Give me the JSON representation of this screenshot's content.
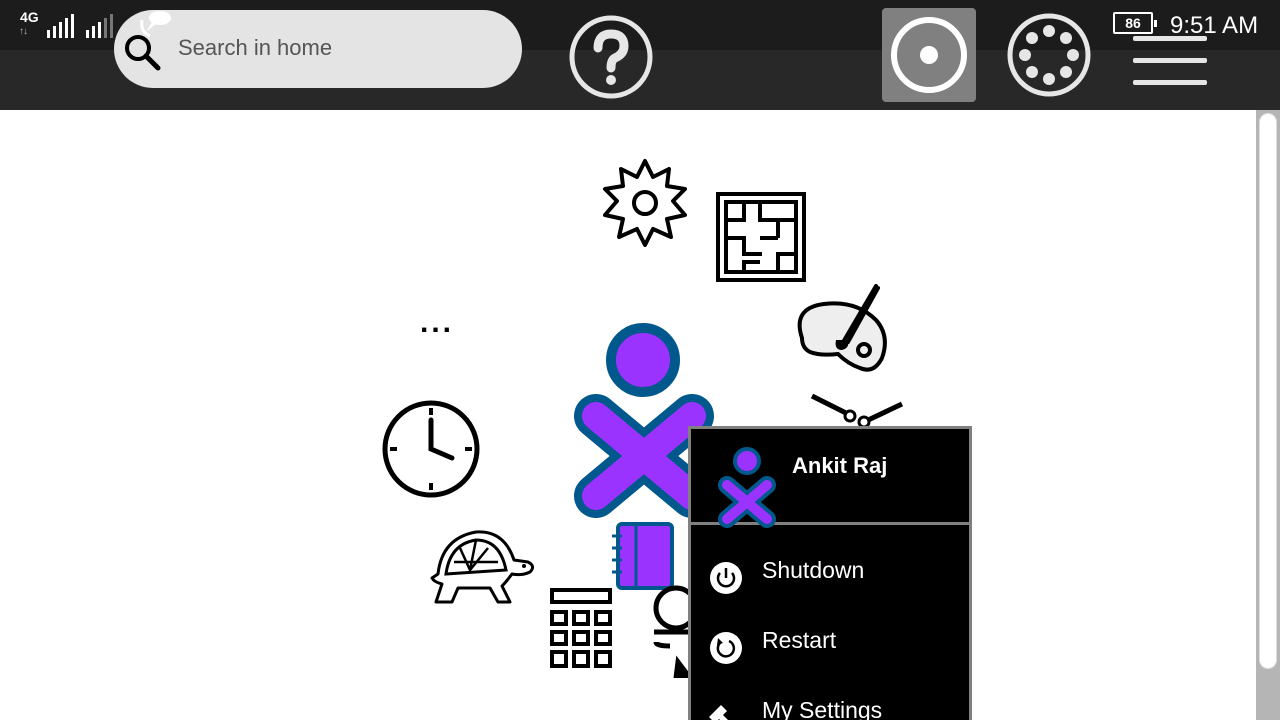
{
  "status_bar": {
    "network": "4G",
    "network_arrows": "↑↓",
    "battery_level": "86",
    "time": "9:51 AM"
  },
  "search": {
    "placeholder": "Search in home"
  },
  "toolbar": {
    "help_icon": "help-icon",
    "favorites_view_icon": "favorites-view-icon",
    "ring_view_icon": "ring-view-icon",
    "list_view_icon": "list-view-icon",
    "active_view": "favorites"
  },
  "home": {
    "activities": [
      "settings-gear-icon",
      "maze-icon",
      "paint-icon",
      "more-dots-icon",
      "clock-icon",
      "turtle-icon",
      "journal-icon",
      "calculator-icon",
      "chat-icon",
      "pendulum-icon"
    ],
    "more_label": "..."
  },
  "popup": {
    "user_name": "Ankit Raj",
    "items": [
      {
        "label": "Shutdown",
        "icon": "power-icon"
      },
      {
        "label": "Restart",
        "icon": "restart-icon"
      },
      {
        "label": "My Settings",
        "icon": "wrench-icon"
      }
    ]
  },
  "colors": {
    "xo_fill": "#9b33ff",
    "xo_stroke": "#00588c",
    "statusbar": "#1c1c1c",
    "toolbar": "#282828",
    "popup_bg": "#000000",
    "popup_border": "#808080"
  }
}
